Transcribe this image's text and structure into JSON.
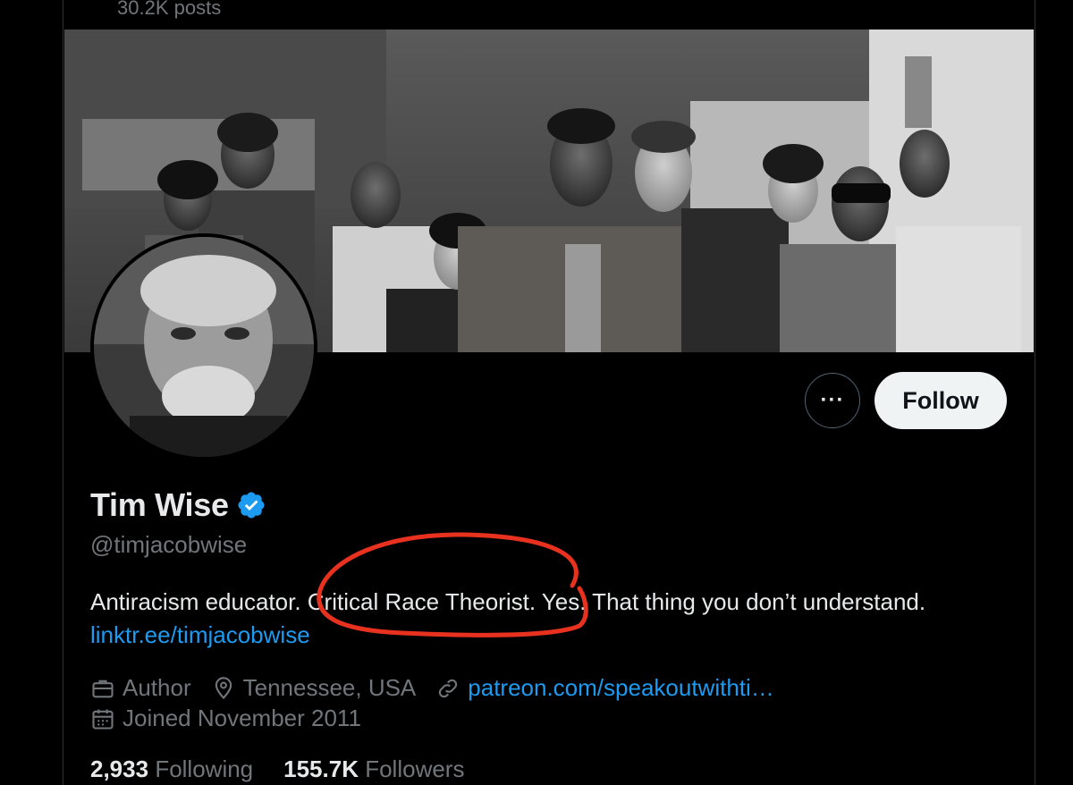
{
  "header": {
    "posts_count": "30.2K posts"
  },
  "profile": {
    "display_name": "Tim Wise",
    "handle": "@timjacobwise",
    "bio": "Antiracism educator. Critical Race Theorist. Yes. That thing you don’t understand.",
    "bio_link": "linktr.ee/timjacobwise",
    "profession": "Author",
    "location": "Tennessee, USA",
    "website": "patreon.com/speakoutwithti…",
    "joined": "Joined November 2011"
  },
  "actions": {
    "more_label": "···",
    "follow_label": "Follow"
  },
  "stats": {
    "following_count": "2,933",
    "following_label": "Following",
    "followers_count": "155.7K",
    "followers_label": "Followers"
  },
  "icons": {
    "verified": "verified-badge-icon",
    "profession": "briefcase-icon",
    "location": "map-pin-icon",
    "website": "link-icon",
    "joined": "calendar-icon"
  },
  "colors": {
    "accent": "#1d9bf0",
    "annotation": "#e8321f"
  }
}
